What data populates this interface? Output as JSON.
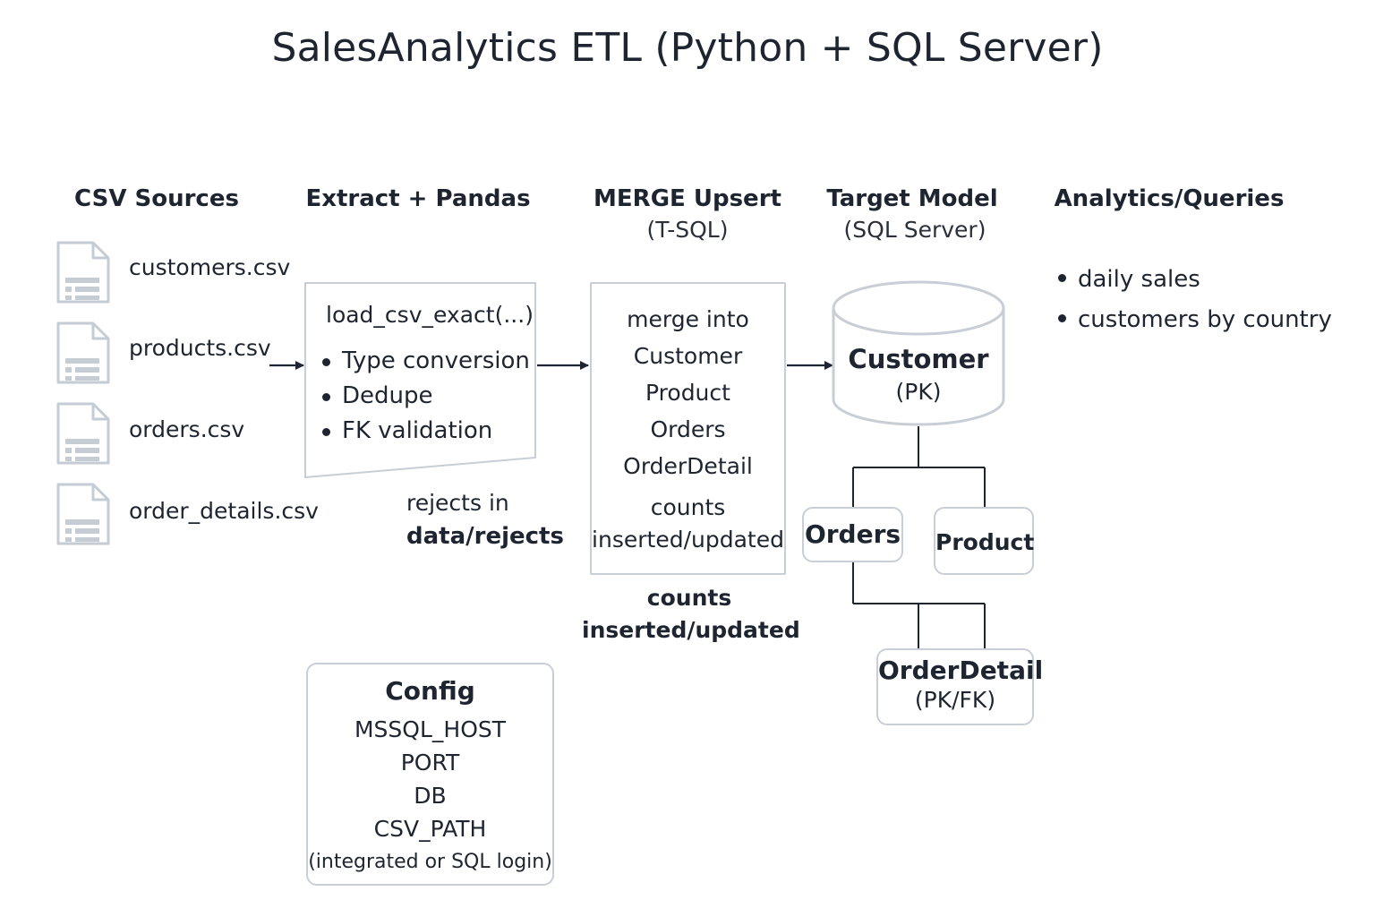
{
  "title": "SalesAnalytics ETL (Python + SQL Server)",
  "columns": {
    "sources": {
      "heading": "CSV Sources"
    },
    "extract": {
      "heading": "Extract + Pandas"
    },
    "merge": {
      "heading": "MERGE Upsert",
      "sub": "(T-SQL)"
    },
    "target": {
      "heading": "Target Model",
      "sub": "(SQL Server)"
    },
    "analytics": {
      "heading": "Analytics/Queries"
    }
  },
  "sources": {
    "files": [
      "customers.csv",
      "products.csv",
      "orders.csv",
      "order_details.csv"
    ]
  },
  "extract": {
    "function": "load_csv_exact(...)",
    "steps": [
      "Type conversion",
      "Dedupe",
      "FK validation"
    ],
    "rejects_prefix": "rejects in",
    "rejects_path": "data/rejects"
  },
  "merge": {
    "lines": [
      "merge into",
      "Customer",
      "Product",
      "Orders",
      "OrderDetail"
    ],
    "counts_line1": "counts",
    "counts_line2": "inserted/updated",
    "below_line1": "counts",
    "below_line2": "inserted/updated"
  },
  "target": {
    "customer": {
      "name": "Customer",
      "key": "(PK)"
    },
    "orders": {
      "name": "Orders"
    },
    "product": {
      "name": "Product"
    },
    "orderdetail": {
      "name": "OrderDetail",
      "key": "(PK/FK)"
    }
  },
  "analytics": {
    "items": [
      "daily sales",
      "customers by country"
    ]
  },
  "config": {
    "title": "Config",
    "lines": [
      "MSSQL_HOST",
      "PORT",
      "DB",
      "CSV_PATH",
      "(integrated or SQL login)"
    ]
  },
  "colors": {
    "text": "#1f2530",
    "border": "#c9ced6",
    "icon": "#c5ccd4",
    "arrow": "#1f2530"
  },
  "icons": {
    "file": "file-document-icon",
    "database": "database-cylinder-icon",
    "arrow": "arrow-right-icon"
  }
}
